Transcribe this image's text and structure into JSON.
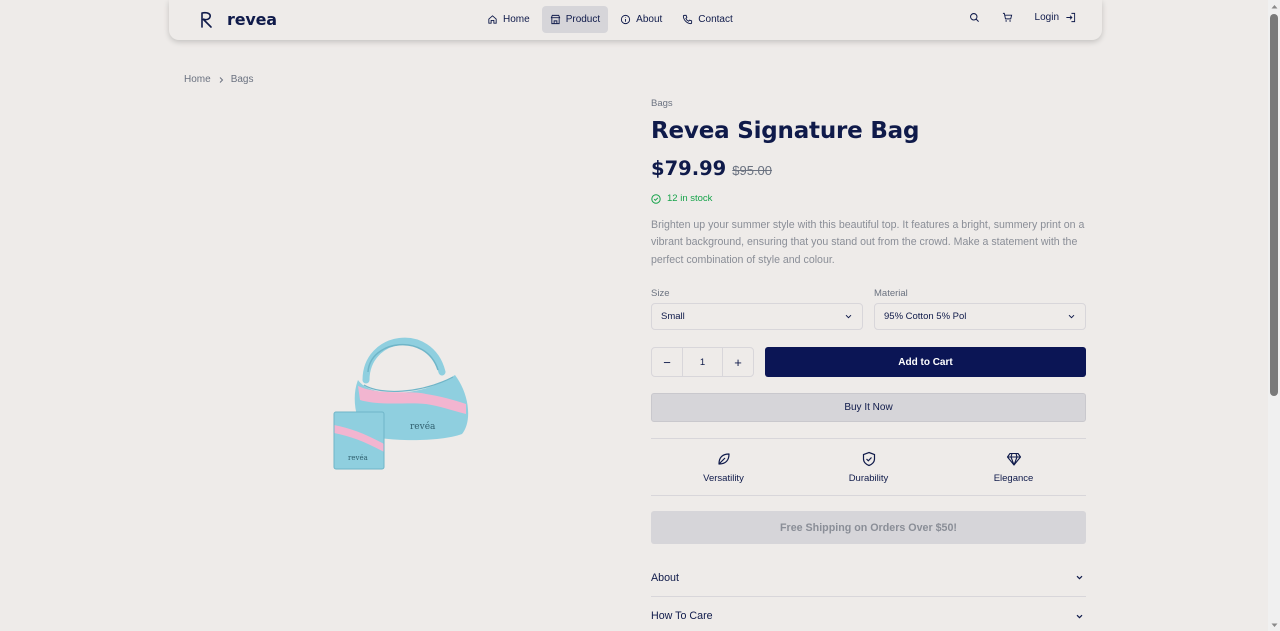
{
  "brand": {
    "name": "revea"
  },
  "nav": {
    "links": [
      {
        "label": "Home",
        "icon": "home-icon"
      },
      {
        "label": "Product",
        "icon": "store-icon",
        "active": true
      },
      {
        "label": "About",
        "icon": "info-icon"
      },
      {
        "label": "Contact",
        "icon": "phone-icon"
      }
    ],
    "login_label": "Login"
  },
  "breadcrumb": {
    "items": [
      "Home",
      "Bags"
    ]
  },
  "product": {
    "category": "Bags",
    "title": "Revea Signature Bag",
    "price": "$79.99",
    "old_price": "$95.00",
    "stock": "12 in stock",
    "description": "Brighten up your summer style with this beautiful top. It features a bright, summery print on a vibrant background, ensuring that you stand out from the crowd. Make a statement with the perfect combination of style and colour.",
    "image_brand_text": "revéa"
  },
  "options": {
    "size": {
      "label": "Size",
      "value": "Small"
    },
    "material": {
      "label": "Material",
      "value": "95% Cotton 5% Pol"
    }
  },
  "quantity": {
    "value": "1",
    "minus": "−",
    "plus": "+"
  },
  "actions": {
    "add_to_cart": "Add to Cart",
    "buy_now": "Buy It Now"
  },
  "features": [
    {
      "label": "Versatility",
      "icon": "leaf-icon"
    },
    {
      "label": "Durability",
      "icon": "shield-check-icon"
    },
    {
      "label": "Elegance",
      "icon": "diamond-icon"
    }
  ],
  "shipping": "Free Shipping on Orders Over $50!",
  "accordion": [
    {
      "label": "About"
    },
    {
      "label": "How To Care"
    }
  ],
  "colors": {
    "navy": "#0b1555",
    "text": "#0f1a4a",
    "muted": "#8a8e97",
    "background": "#eeebe9",
    "stock_green": "#16a34a",
    "bag_blue": "#8fcfdf",
    "bag_pink": "#f2b5d0"
  }
}
